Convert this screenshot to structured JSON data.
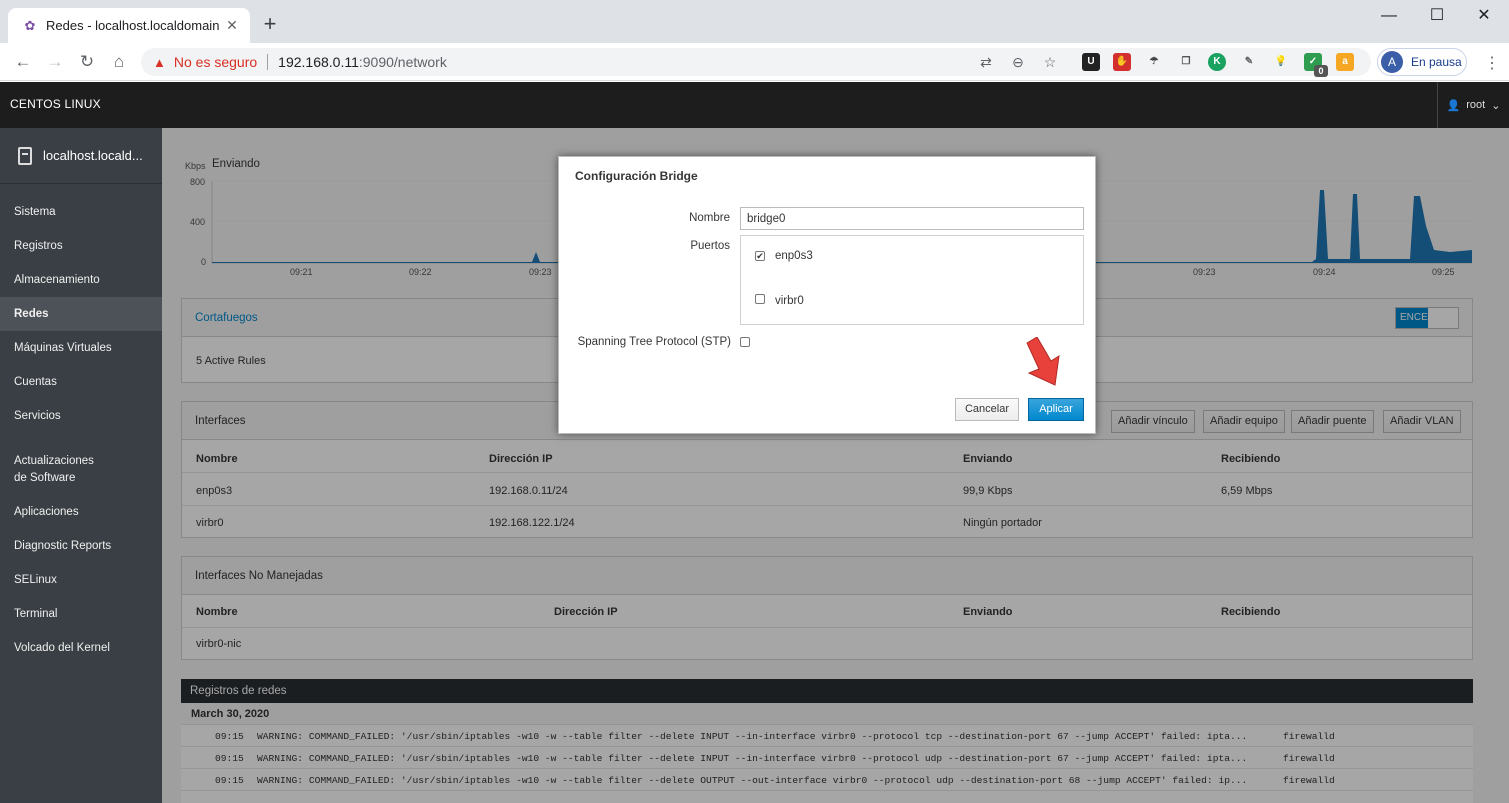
{
  "browser": {
    "tab_title": "Redes - localhost.localdomain",
    "tab_close": "✕",
    "new_tab": "+",
    "win_min": "—",
    "win_max": "☐",
    "win_close": "✕",
    "not_secure_label": "No es seguro",
    "url_host": "192.168.0.11",
    "url_rest": ":9090/network",
    "profile_initial": "A",
    "profile_label": "En pausa",
    "extension_badge": "0"
  },
  "cockpit": {
    "brand": "CENTOS LINUX",
    "user": "root"
  },
  "sidebar": {
    "host": "localhost.locald...",
    "items": [
      {
        "label": "Sistema"
      },
      {
        "label": "Registros"
      },
      {
        "label": "Almacenamiento"
      },
      {
        "label": "Redes",
        "active": true
      },
      {
        "label": "Máquinas Virtuales"
      },
      {
        "label": "Cuentas"
      },
      {
        "label": "Servicios"
      },
      {
        "label": "Actualizaciones de Software"
      },
      {
        "label": "Aplicaciones"
      },
      {
        "label": "Diagnostic Reports"
      },
      {
        "label": "SELinux"
      },
      {
        "label": "Terminal"
      },
      {
        "label": "Volcado del Kernel"
      }
    ]
  },
  "chart": {
    "unit": "Kbps",
    "title": "Enviando",
    "y_ticks": [
      "800",
      "400",
      "0"
    ],
    "x_ticks_left": [
      "09:21",
      "09:22",
      "09:23"
    ],
    "x_ticks_right": [
      "09:23",
      "09:24",
      "09:25"
    ]
  },
  "firewall": {
    "title": "Cortafuegos",
    "rules": "5 Active Rules",
    "toggle": "ENCENDIDO"
  },
  "interfaces": {
    "title": "Interfaces",
    "buttons": [
      "Añadir vínculo",
      "Añadir equipo",
      "Añadir puente",
      "Añadir VLAN"
    ],
    "columns": [
      "Nombre",
      "Dirección IP",
      "Enviando",
      "Recibiendo"
    ],
    "rows": [
      {
        "name": "enp0s3",
        "ip": "192.168.0.11/24",
        "sending": "99,9 Kbps",
        "receiving": "6,59 Mbps"
      },
      {
        "name": "virbr0",
        "ip": "192.168.122.1/24",
        "sending": "Ningún portador",
        "receiving": ""
      }
    ]
  },
  "unmanaged": {
    "title": "Interfaces No Manejadas",
    "columns": [
      "Nombre",
      "Dirección IP",
      "Enviando",
      "Recibiendo"
    ],
    "rows": [
      {
        "name": "virbr0-nic"
      }
    ]
  },
  "logs": {
    "title": "Registros de redes",
    "date": "March 30, 2020",
    "entries": [
      {
        "time": "09:15",
        "message": "WARNING: COMMAND_FAILED: '/usr/sbin/iptables -w10 -w --table filter --delete INPUT --in-interface virbr0 --protocol tcp --destination-port 67 --jump ACCEPT' failed: ipta...",
        "source": "firewalld"
      },
      {
        "time": "09:15",
        "message": "WARNING: COMMAND_FAILED: '/usr/sbin/iptables -w10 -w --table filter --delete INPUT --in-interface virbr0 --protocol udp --destination-port 67 --jump ACCEPT' failed: ipta...",
        "source": "firewalld"
      },
      {
        "time": "09:15",
        "message": "WARNING: COMMAND_FAILED: '/usr/sbin/iptables -w10 -w --table filter --delete OUTPUT --out-interface virbr0 --protocol udp --destination-port 68 --jump ACCEPT' failed: ip...",
        "source": "firewalld"
      }
    ]
  },
  "modal": {
    "title": "Configuración Bridge",
    "name_label": "Nombre",
    "name_value": "bridge0",
    "ports_label": "Puertos",
    "ports": [
      {
        "name": "enp0s3",
        "checked": true
      },
      {
        "name": "virbr0",
        "checked": false
      }
    ],
    "stp_label": "Spanning Tree Protocol (STP)",
    "stp_checked": false,
    "cancel": "Cancelar",
    "apply": "Aplicar"
  },
  "colors": {
    "accent": "#0088ce",
    "chart_fill": "#1f77b4",
    "arrow": "#e8413b"
  }
}
